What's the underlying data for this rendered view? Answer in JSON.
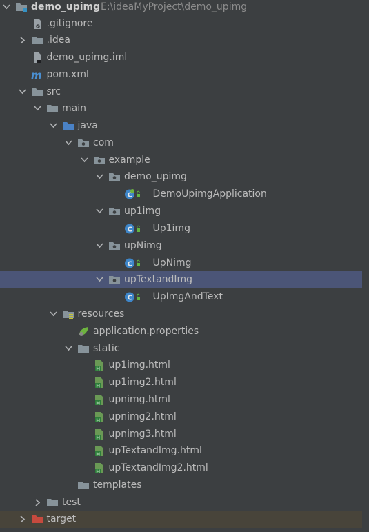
{
  "tree": {
    "root": {
      "name": "demo_upimg",
      "path": "E:\\ideaMyProject\\demo_upimg"
    },
    "items": [
      {
        "label": "demo_upimg",
        "icon": "module-folder-icon"
      },
      {
        "label": ".gitignore",
        "icon": "gitignore-file-icon"
      },
      {
        "label": ".idea",
        "icon": "folder-icon"
      },
      {
        "label": "demo_upimg.iml",
        "icon": "iml-file-icon"
      },
      {
        "label": "pom.xml",
        "icon": "maven-icon"
      },
      {
        "label": "src",
        "icon": "folder-icon"
      },
      {
        "label": "main",
        "icon": "folder-icon"
      },
      {
        "label": "java",
        "icon": "source-folder-icon"
      },
      {
        "label": "com",
        "icon": "package-icon"
      },
      {
        "label": "example",
        "icon": "package-icon"
      },
      {
        "label": "demo_upimg",
        "icon": "package-icon"
      },
      {
        "label": "DemoUpimgApplication",
        "icon": "spring-boot-class-icon"
      },
      {
        "label": "up1img",
        "icon": "package-icon"
      },
      {
        "label": "Up1img",
        "icon": "class-icon"
      },
      {
        "label": "upNimg",
        "icon": "package-icon"
      },
      {
        "label": "UpNimg",
        "icon": "class-icon"
      },
      {
        "label": "upTextandImg",
        "icon": "package-icon"
      },
      {
        "label": "UpImgAndText",
        "icon": "class-icon"
      },
      {
        "label": "resources",
        "icon": "resources-folder-icon"
      },
      {
        "label": "application.properties",
        "icon": "spring-properties-icon"
      },
      {
        "label": "static",
        "icon": "folder-icon"
      },
      {
        "label": "up1img.html",
        "icon": "html-file-icon"
      },
      {
        "label": "up1img2.html",
        "icon": "html-file-icon"
      },
      {
        "label": "upnimg.html",
        "icon": "html-file-icon"
      },
      {
        "label": "upnimg2.html",
        "icon": "html-file-icon"
      },
      {
        "label": "upnimg3.html",
        "icon": "html-file-icon"
      },
      {
        "label": "upTextandImg.html",
        "icon": "html-file-icon"
      },
      {
        "label": "upTextandImg2.html",
        "icon": "html-file-icon"
      },
      {
        "label": "templates",
        "icon": "folder-icon"
      },
      {
        "label": "test",
        "icon": "folder-icon"
      },
      {
        "label": "target",
        "icon": "excluded-folder-icon"
      }
    ]
  },
  "colors": {
    "background": "#3c3f41",
    "selected_row": "#4b5577",
    "excluded_row": "#48443a",
    "text": "#bbbbbb",
    "path_text": "#8c8c8c"
  }
}
